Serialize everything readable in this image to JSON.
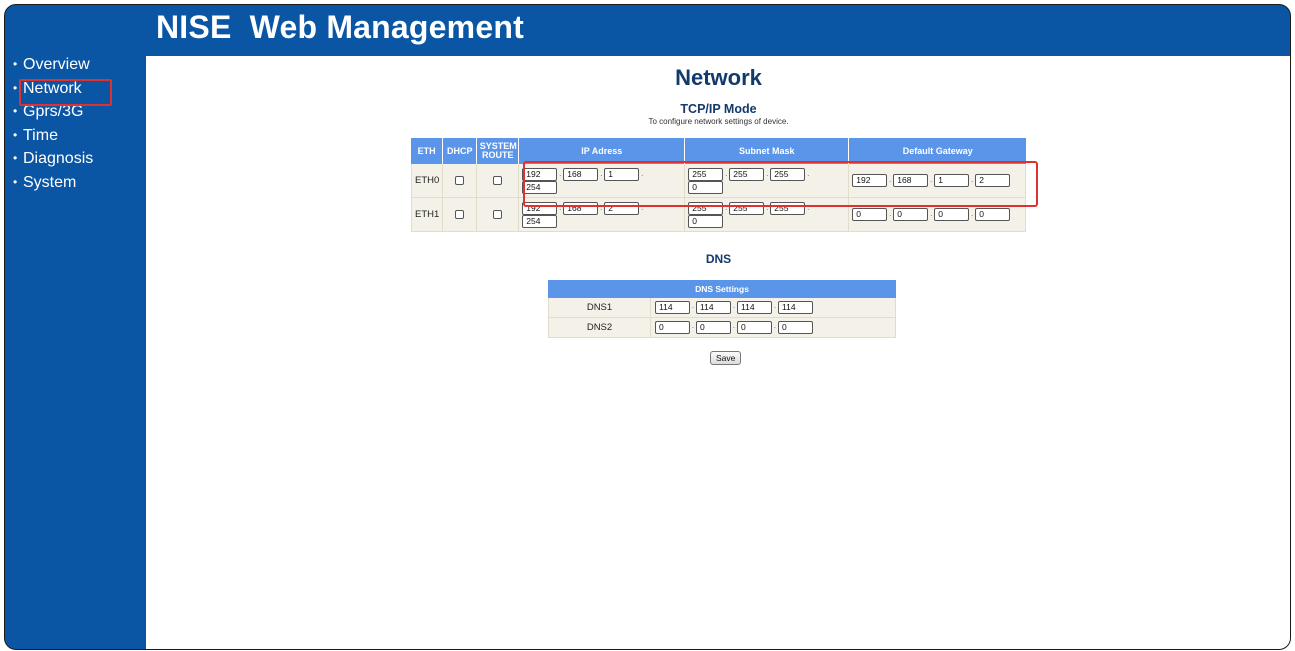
{
  "app_title": "NISE  Web Management",
  "sidebar": {
    "items": [
      {
        "label": "Overview"
      },
      {
        "label": "Network",
        "active": true
      },
      {
        "label": "Gprs/3G"
      },
      {
        "label": "Time"
      },
      {
        "label": "Diagnosis"
      },
      {
        "label": "System"
      }
    ]
  },
  "page": {
    "title": "Network",
    "section_title": "TCP/IP Mode",
    "section_subtitle": "To configure network settings of device."
  },
  "eth_table": {
    "headers": [
      "ETH",
      "DHCP",
      "SYSTEM ROUTE",
      "IP Adress",
      "Subnet Mask",
      "Default Gateway"
    ],
    "rows": [
      {
        "name": "ETH0",
        "dhcp": false,
        "system_route": false,
        "ip": [
          "192",
          "168",
          "1",
          "254"
        ],
        "mask": [
          "255",
          "255",
          "255",
          "0"
        ],
        "gateway": [
          "192",
          "168",
          "1",
          "2"
        ]
      },
      {
        "name": "ETH1",
        "dhcp": false,
        "system_route": false,
        "ip": [
          "192",
          "168",
          "2",
          "254"
        ],
        "mask": [
          "255",
          "255",
          "255",
          "0"
        ],
        "gateway": [
          "0",
          "0",
          "0",
          "0"
        ]
      }
    ]
  },
  "dns": {
    "title": "DNS",
    "table_header": "DNS Settings",
    "rows": [
      {
        "label": "DNS1",
        "octets": [
          "114",
          "114",
          "114",
          "114"
        ]
      },
      {
        "label": "DNS2",
        "octets": [
          "0",
          "0",
          "0",
          "0"
        ]
      }
    ]
  },
  "save_label": "Save",
  "colors": {
    "frame_blue": "#0a55a4",
    "header_blue": "#5a95ea",
    "highlight_red": "#e03131",
    "cell_bg": "#f4f1e9"
  }
}
